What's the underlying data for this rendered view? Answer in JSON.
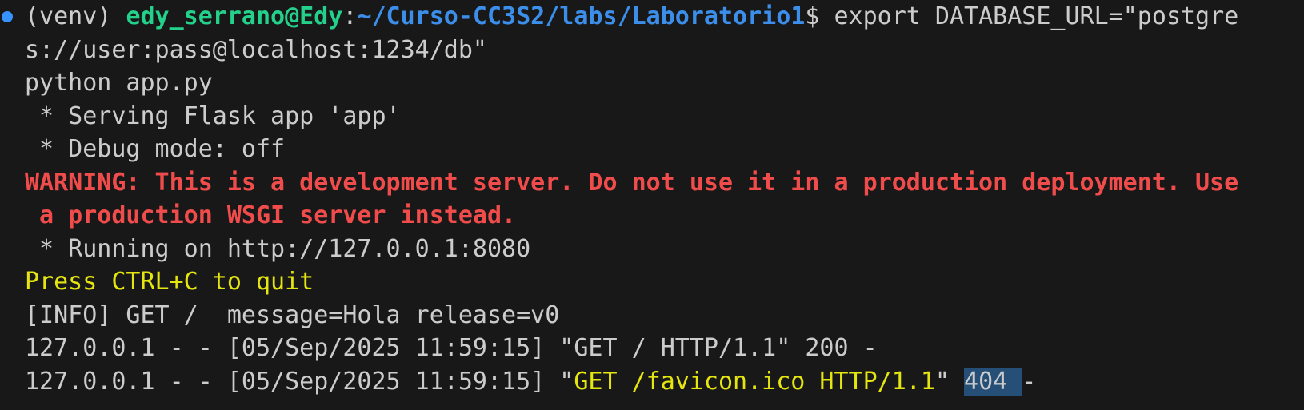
{
  "terminal": {
    "prompt": {
      "venv": "(venv) ",
      "user_host": "edy_serrano@Edy",
      "colon": ":",
      "path": "~/Curso-CC3S2/labs/Laboratorio1",
      "symbol": "$ ",
      "command_part1": "export DATABASE_URL=\"postgre",
      "command_part2": "s://user:pass@localhost:1234/db\""
    },
    "command2": "python app.py",
    "serving": " * Serving Flask app 'app'",
    "debug": " * Debug mode: off",
    "warning_line1": "WARNING: This is a development server. Do not use it in a production deployment. Use",
    "warning_line2": " a production WSGI server instead.",
    "running": " * Running on http://127.0.0.1:8080",
    "quit_hint": "Press CTRL+C to quit",
    "info": "[INFO] GET /  message=Hola release=v0",
    "access_log_1": "127.0.0.1 - - [05/Sep/2025 11:59:15] \"GET / HTTP/1.1\" 200 -",
    "access_log_2": {
      "prefix": "127.0.0.1 - - [05/Sep/2025 11:59:15] \"",
      "request": "GET /favicon.ico HTTP/1.1",
      "quote": "\" ",
      "status": "404 ",
      "suffix": "-"
    }
  },
  "colors": {
    "background": "#181818",
    "text": "#cccccc",
    "user_green": "#23d18b",
    "path_blue": "#3b8eea",
    "warning_red": "#f14c4c",
    "yellow": "#e5e510",
    "selection": "#264f78",
    "status_dot": "#3794ff"
  }
}
